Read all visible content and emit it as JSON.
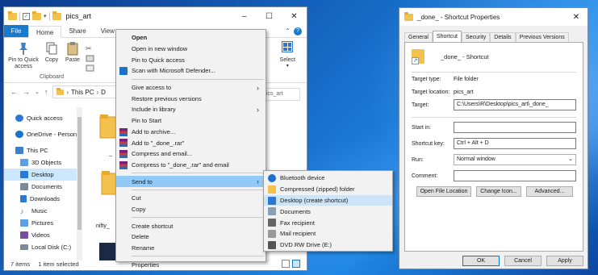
{
  "explorer": {
    "title": "pics_art",
    "window_controls": [
      "–",
      "☐",
      "✕"
    ],
    "ribbon_tabs": [
      "File",
      "Home",
      "Share",
      "View"
    ],
    "ribbon_buttons": [
      "Pin to Quick access",
      "Copy",
      "Paste"
    ],
    "clipboard_label": "Clipboard",
    "select_label": "Select",
    "address_crumbs": [
      "This PC",
      "D"
    ],
    "search_text": "pics_art",
    "nav_items": [
      {
        "label": "Quick access",
        "color": "#2b79d3"
      },
      {
        "label": "OneDrive - Person",
        "color": "#1a73c8"
      },
      {
        "label": "This PC",
        "color": "#3d7fc9"
      },
      {
        "label": "3D Objects",
        "color": "#5aa0e6"
      },
      {
        "label": "Desktop",
        "color": "#2b79d3"
      },
      {
        "label": "Documents",
        "color": "#7a8a9a"
      },
      {
        "label": "Downloads",
        "color": "#2b79d3"
      },
      {
        "label": "Music",
        "color": "#2b79d3"
      },
      {
        "label": "Pictures",
        "color": "#5aa0e6"
      },
      {
        "label": "Videos",
        "color": "#7a4fa0"
      },
      {
        "label": "Local Disk (C:)",
        "color": "#7a8a9a"
      }
    ],
    "file_labels": [
      "_",
      "nifty_"
    ],
    "status_items": "7 items",
    "status_selected": "1 item selected"
  },
  "context_menu": {
    "items": [
      {
        "label": "Open",
        "bold": true
      },
      {
        "label": "Open in new window"
      },
      {
        "label": "Pin to Quick access"
      },
      {
        "label": "Scan with Microsoft Defender...",
        "icon": "defender-icon"
      },
      {
        "sep": true
      },
      {
        "label": "Give access to",
        "submenu": true
      },
      {
        "label": "Restore previous versions"
      },
      {
        "label": "Include in library",
        "submenu": true
      },
      {
        "label": "Pin to Start"
      },
      {
        "label": "Add to archive...",
        "icon": "winrar-icon"
      },
      {
        "label": "Add to \"_done_.rar\"",
        "icon": "winrar-icon"
      },
      {
        "label": "Compress and email...",
        "icon": "winrar-icon"
      },
      {
        "label": "Compress to \"_done_.rar\" and email",
        "icon": "winrar-icon"
      },
      {
        "sep": true
      },
      {
        "label": "Send to",
        "submenu": true,
        "highlight": true
      },
      {
        "sep": true
      },
      {
        "label": "Cut"
      },
      {
        "label": "Copy"
      },
      {
        "sep": true
      },
      {
        "label": "Create shortcut"
      },
      {
        "label": "Delete"
      },
      {
        "label": "Rename"
      },
      {
        "sep": true
      },
      {
        "label": "Properties"
      }
    ]
  },
  "send_to_menu": {
    "items": [
      {
        "label": "Bluetooth device",
        "icon": "bluetooth-icon",
        "color": "#1a73c8"
      },
      {
        "label": "Compressed (zipped) folder",
        "icon": "zip-folder-icon",
        "color": "#f3c14d"
      },
      {
        "label": "Desktop (create shortcut)",
        "icon": "desktop-icon",
        "color": "#2b79d3",
        "highlight": true
      },
      {
        "label": "Documents",
        "icon": "documents-icon",
        "color": "#8aa0b5"
      },
      {
        "label": "Fax recipient",
        "icon": "fax-icon",
        "color": "#666666"
      },
      {
        "label": "Mail recipient",
        "icon": "mail-icon",
        "color": "#999999"
      },
      {
        "label": "DVD RW Drive (E:)",
        "icon": "dvd-drive-icon",
        "color": "#555555"
      }
    ]
  },
  "properties": {
    "title": "_done_ - Shortcut Properties",
    "tabs": [
      "General",
      "Shortcut",
      "Security",
      "Details",
      "Previous Versions"
    ],
    "active_tab": "Shortcut",
    "shortcut_name": "_done_ - Shortcut",
    "target_type_label": "Target type:",
    "target_type": "File folder",
    "target_location_label": "Target location:",
    "target_location": "pics_art",
    "target_label": "Target:",
    "target_value": "C:\\Users\\R\\Desktop\\pics_art\\_done_",
    "start_in_label": "Start in:",
    "start_in_value": "",
    "shortcut_key_label": "Shortcut key:",
    "shortcut_key_value": "Ctrl + Alt + D",
    "run_label": "Run:",
    "run_value": "Normal window",
    "comment_label": "Comment:",
    "comment_value": "",
    "btn_open_location": "Open File Location",
    "btn_change_icon": "Change Icon...",
    "btn_advanced": "Advanced...",
    "btn_ok": "OK",
    "btn_cancel": "Cancel",
    "btn_apply": "Apply"
  }
}
